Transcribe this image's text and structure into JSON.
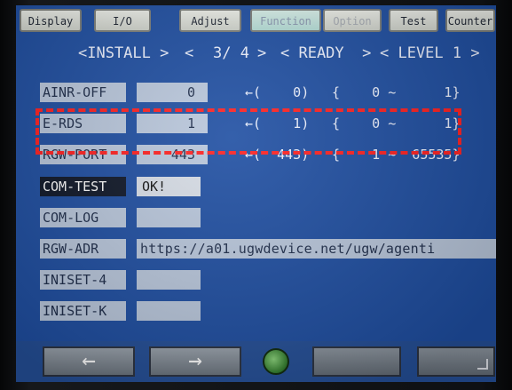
{
  "tabs": [
    {
      "label": "Display"
    },
    {
      "label": "I/O"
    },
    {
      "label": "Adjust"
    },
    {
      "label": "Function"
    },
    {
      "label": "Option"
    },
    {
      "label": "Test"
    },
    {
      "label": "Counter"
    }
  ],
  "header": {
    "install": "<INSTALL >",
    "prev": "<",
    "page": "3/ 4",
    "next": ">",
    "status": "< READY  >",
    "level": "< LEVEL 1 >"
  },
  "rows": {
    "ainr_off": {
      "label": "AINR-OFF",
      "value": "0",
      "default": "←(    0)",
      "range": "{    0 ~      1}"
    },
    "e_rds": {
      "label": "E-RDS",
      "value": "1",
      "default": "←(    1)",
      "range": "{    0 ~      1}"
    },
    "rgw_port": {
      "label": "RGW-PORT",
      "value": "443",
      "default": "←(  443)",
      "range": "{    1 ~  65535}"
    },
    "com_test": {
      "label": "COM-TEST",
      "value": "OK!"
    },
    "com_log": {
      "label": "COM-LOG",
      "value": ""
    },
    "rgw_adr": {
      "label": "RGW-ADR",
      "value": "https://a01.ugwdevice.net/ugw/agenti"
    },
    "iniset_4": {
      "label": "INISET-4",
      "value": ""
    },
    "iniset_k": {
      "label": "INISET-K",
      "value": ""
    }
  },
  "bottom": {
    "left_arrow": "←",
    "right_arrow": "→"
  },
  "icons": [
    "left-arrow-icon",
    "right-arrow-icon",
    "status-led-icon",
    "corner-icon"
  ],
  "colors": {
    "screen": "#1e4ea2",
    "field": "#b9c7dc",
    "highlight": "#ff1f1f"
  }
}
